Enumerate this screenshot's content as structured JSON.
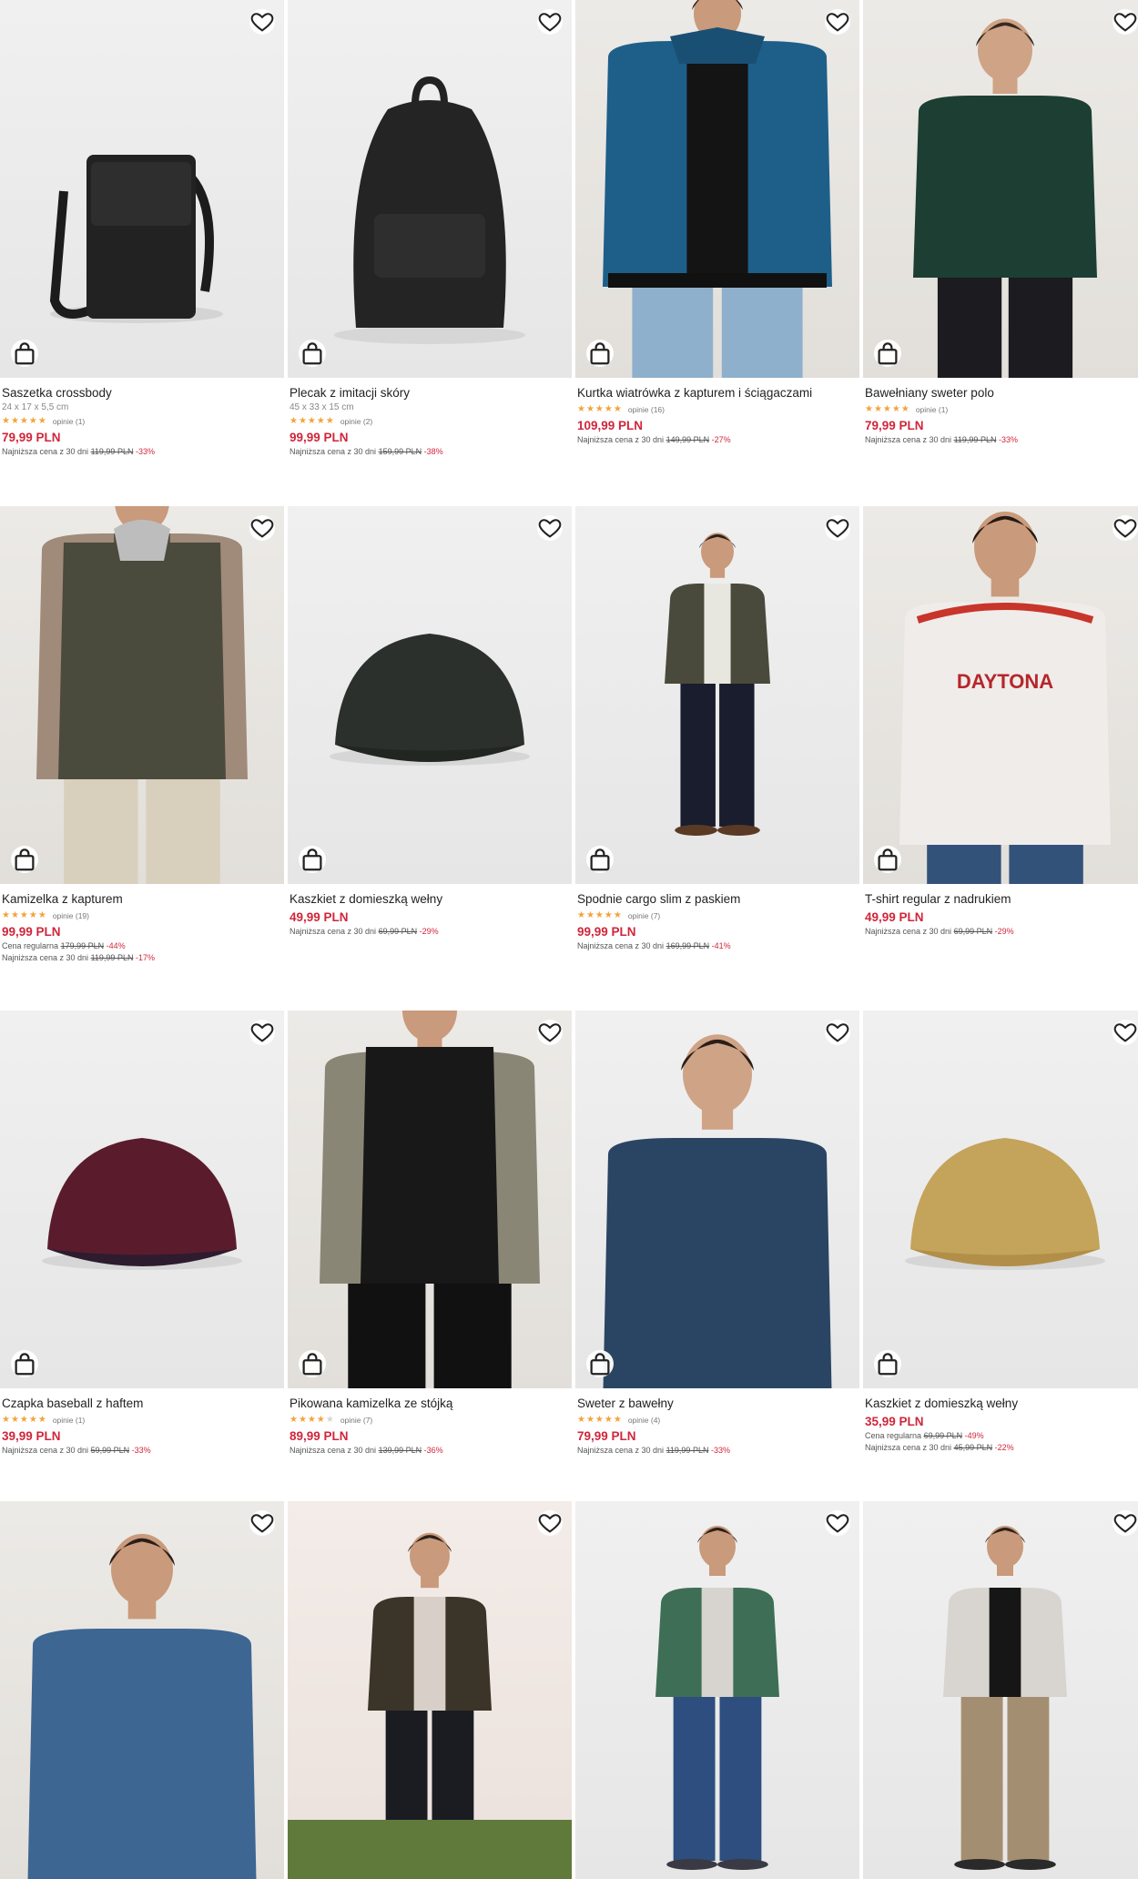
{
  "colors": {
    "price": "#d0263a",
    "stars": "#f2a33a"
  },
  "products": [
    {
      "name": "Saszetka crossbody",
      "dims": "24 x 17 x 5,5 cm",
      "stars": 5,
      "reviews": "opinie (1)",
      "price": "79,99 PLN",
      "lines": [
        {
          "label": "Najniższa cena z 30 dni",
          "old": "119,99 PLN",
          "pct": "-33%"
        }
      ]
    },
    {
      "name": "Plecak z imitacji skóry",
      "dims": "45 x 33 x 15 cm",
      "stars": 5,
      "reviews": "opinie (2)",
      "price": "99,99 PLN",
      "lines": [
        {
          "label": "Najniższa cena z 30 dni",
          "old": "159,99 PLN",
          "pct": "-38%"
        }
      ]
    },
    {
      "name": "Kurtka wiatrówka z kapturem i ściągaczami",
      "dims": "",
      "stars": 5,
      "reviews": "opinie (16)",
      "price": "109,99 PLN",
      "lines": [
        {
          "label": "Najniższa cena z 30 dni",
          "old": "149,99 PLN",
          "pct": "-27%"
        }
      ]
    },
    {
      "name": "Bawełniany sweter polo",
      "dims": "",
      "stars": 5,
      "reviews": "opinie (1)",
      "price": "79,99 PLN",
      "lines": [
        {
          "label": "Najniższa cena z 30 dni",
          "old": "119,99 PLN",
          "pct": "-33%"
        }
      ]
    },
    {
      "name": "Kamizelka z kapturem",
      "dims": "",
      "stars": 5,
      "reviews": "opinie (19)",
      "price": "99,99 PLN",
      "lines": [
        {
          "label": "Cena regularna",
          "old": "179,99 PLN",
          "pct": "-44%"
        },
        {
          "label": "Najniższa cena z 30 dni",
          "old": "119,99 PLN",
          "pct": "-17%"
        }
      ]
    },
    {
      "name": "Kaszkiet z domieszką wełny",
      "dims": "",
      "stars": 0,
      "reviews": "",
      "price": "49,99 PLN",
      "lines": [
        {
          "label": "Najniższa cena z 30 dni",
          "old": "69,99 PLN",
          "pct": "-29%"
        }
      ]
    },
    {
      "name": "Spodnie cargo slim z paskiem",
      "dims": "",
      "stars": 5,
      "reviews": "opinie (7)",
      "price": "99,99 PLN",
      "lines": [
        {
          "label": "Najniższa cena z 30 dni",
          "old": "169,99 PLN",
          "pct": "-41%"
        }
      ]
    },
    {
      "name": "T-shirt regular z nadrukiem",
      "dims": "",
      "stars": 0,
      "reviews": "",
      "price": "49,99 PLN",
      "lines": [
        {
          "label": "Najniższa cena z 30 dni",
          "old": "69,99 PLN",
          "pct": "-29%"
        }
      ]
    },
    {
      "name": "Czapka baseball z haftem",
      "dims": "",
      "stars": 5,
      "reviews": "opinie (1)",
      "price": "39,99 PLN",
      "lines": [
        {
          "label": "Najniższa cena z 30 dni",
          "old": "59,99 PLN",
          "pct": "-33%"
        }
      ]
    },
    {
      "name": "Pikowana kamizelka ze stójką",
      "dims": "",
      "stars": 4,
      "reviews": "opinie (7)",
      "price": "89,99 PLN",
      "lines": [
        {
          "label": "Najniższa cena z 30 dni",
          "old": "139,99 PLN",
          "pct": "-36%"
        }
      ]
    },
    {
      "name": "Sweter z bawełny",
      "dims": "",
      "stars": 5,
      "reviews": "opinie (4)",
      "price": "79,99 PLN",
      "lines": [
        {
          "label": "Najniższa cena z 30 dni",
          "old": "119,99 PLN",
          "pct": "-33%"
        }
      ]
    },
    {
      "name": "Kaszkiet z domieszką wełny",
      "dims": "",
      "stars": 0,
      "reviews": "",
      "price": "35,99 PLN",
      "lines": [
        {
          "label": "Cena regularna",
          "old": "69,99 PLN",
          "pct": "-49%"
        },
        {
          "label": "Najniższa cena z 30 dni",
          "old": "45,99 PLN",
          "pct": "-22%"
        }
      ]
    },
    {
      "name": "",
      "dims": "",
      "stars": 0,
      "reviews": "",
      "price": "",
      "lines": []
    },
    {
      "name": "",
      "dims": "",
      "stars": 0,
      "reviews": "",
      "price": "",
      "lines": []
    },
    {
      "name": "",
      "dims": "",
      "stars": 0,
      "reviews": "",
      "price": "",
      "lines": []
    },
    {
      "name": "",
      "dims": "",
      "stars": 0,
      "reviews": "",
      "price": "",
      "lines": []
    }
  ],
  "icons": {
    "wishlist": "heart-icon",
    "cart": "shopping-bag-icon"
  },
  "graphics": {
    "tshirt_print": "DAYTONA"
  }
}
